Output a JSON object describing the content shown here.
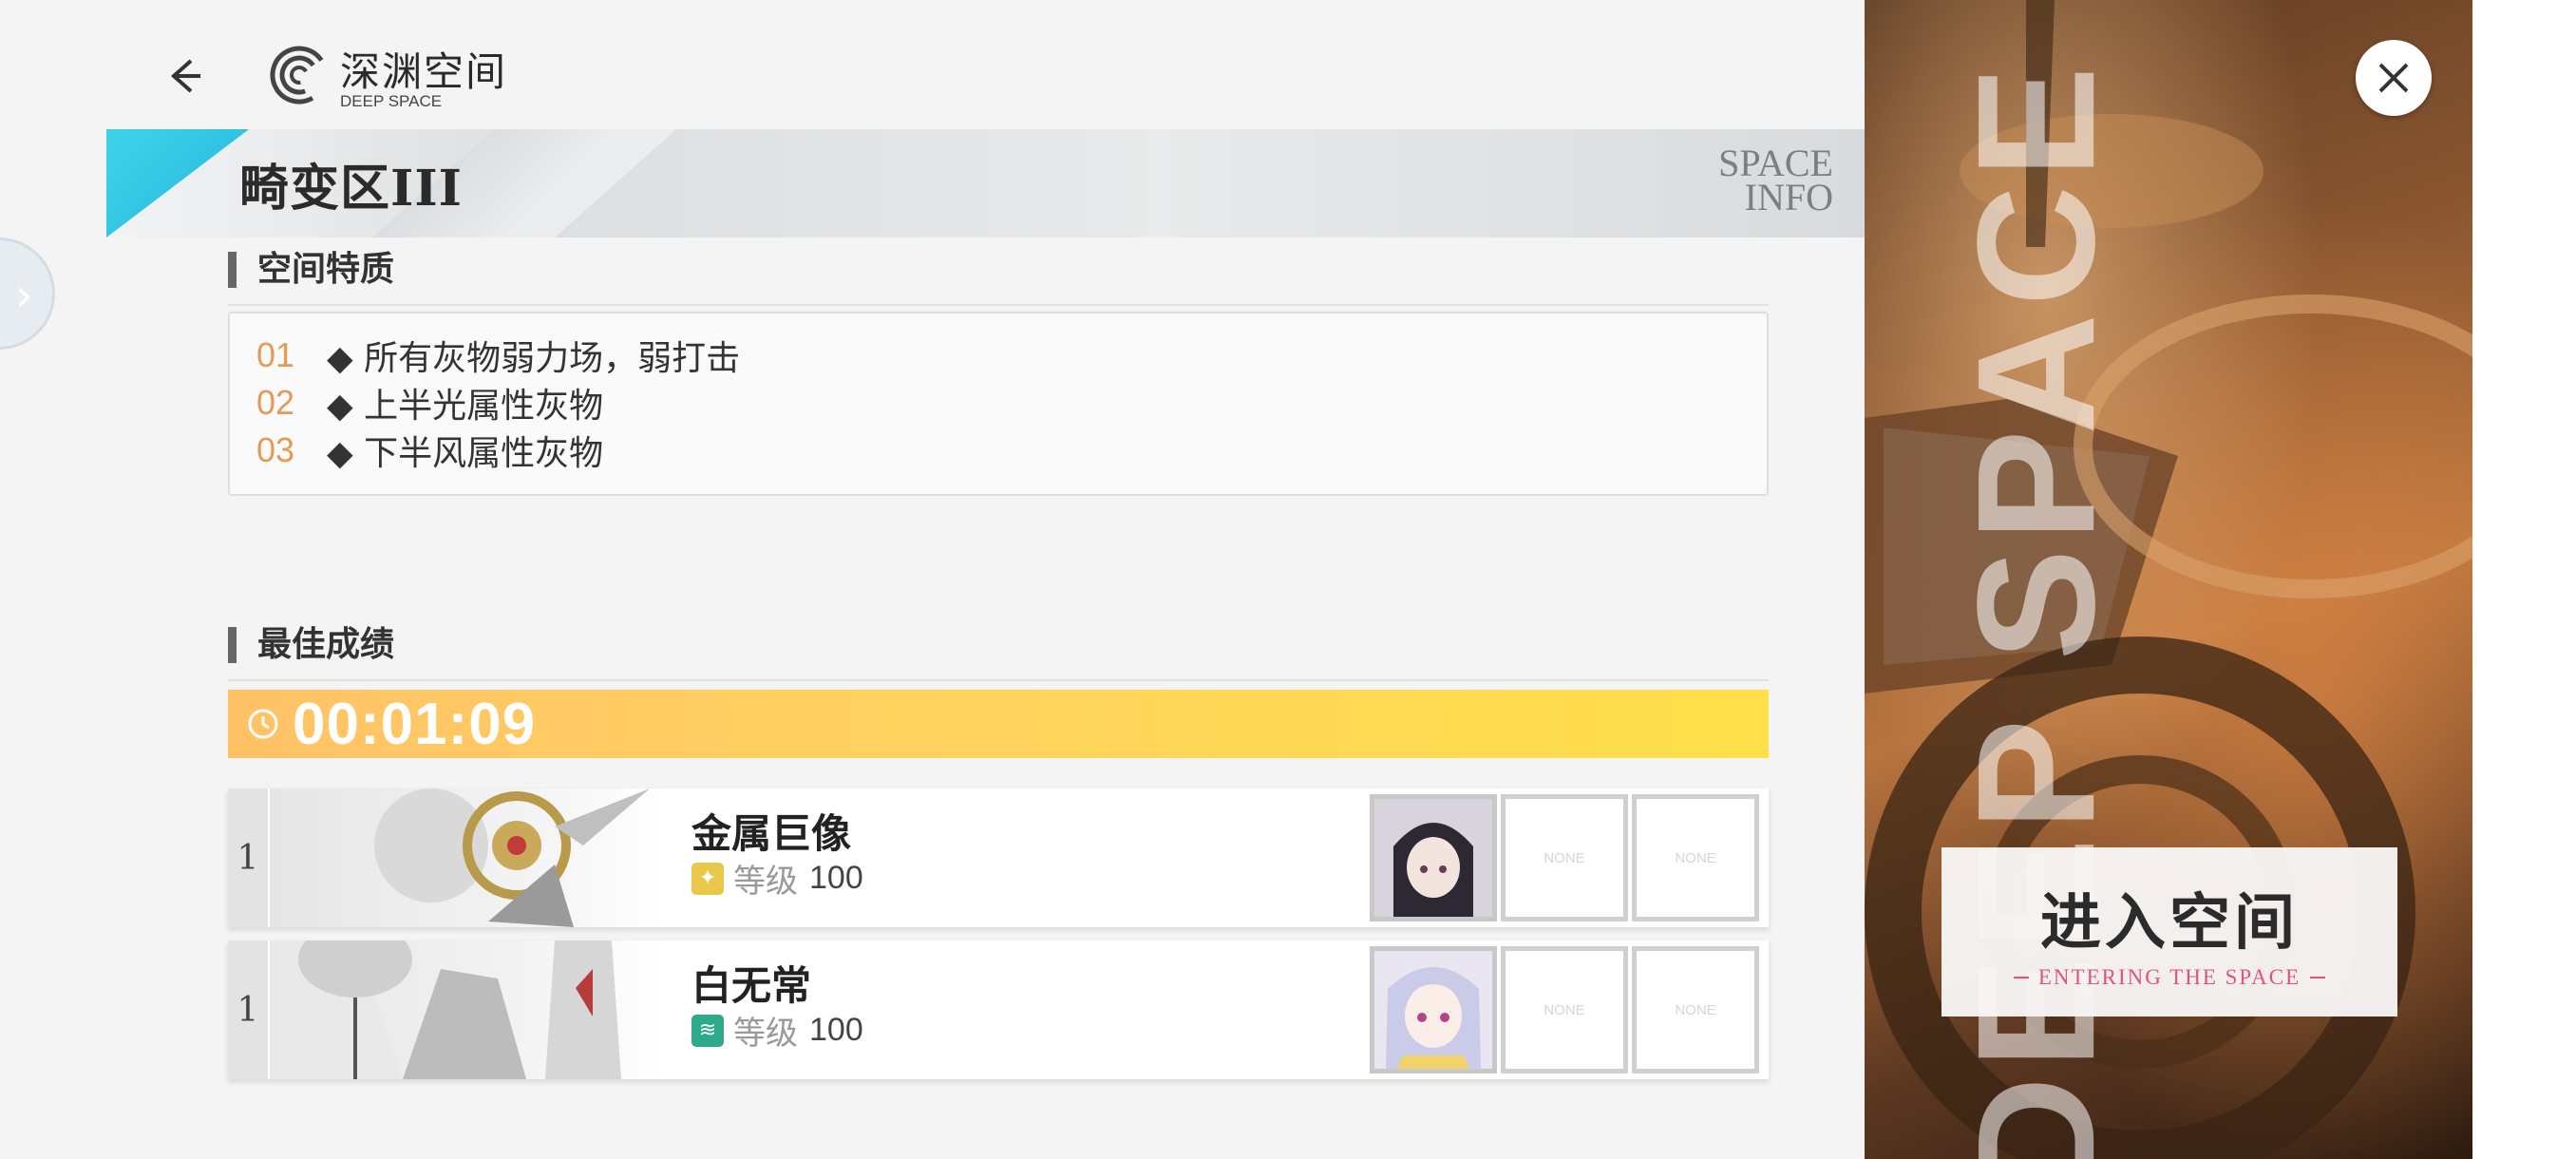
{
  "header": {
    "back_icon": "arrow-left-icon",
    "logo_icon": "spiral-logo-icon",
    "title": "深渊空间",
    "subtitle": "DEEP SPACE"
  },
  "banner": {
    "zone_title": "畸变区III",
    "side_text_line1": "SPACE",
    "side_text_line2": "INFO",
    "accent_color": "#2cc4e3"
  },
  "traits": {
    "heading": "空间特质",
    "items": [
      {
        "num": "01",
        "text": "◆ 所有灰物弱力场，弱打击"
      },
      {
        "num": "02",
        "text": "◆ 上半光属性灰物"
      },
      {
        "num": "03",
        "text": "◆ 下半风属性灰物"
      }
    ]
  },
  "best": {
    "heading": "最佳成绩",
    "time": "00:01:09",
    "clock_icon": "clock-icon",
    "bar_color": "#ffcc5e"
  },
  "bosses": [
    {
      "rank": "1",
      "name": "金属巨像",
      "element_icon": "light-element-icon",
      "element_color": "#e8c74a",
      "level_label": "等级",
      "level_value": "100",
      "slots": [
        "NONE",
        "NONE"
      ]
    },
    {
      "rank": "1",
      "name": "白无常",
      "element_icon": "wind-element-icon",
      "element_color": "#2fa98c",
      "level_label": "等级",
      "level_value": "100",
      "slots": [
        "NONE",
        "NONE"
      ]
    }
  ],
  "right_panel": {
    "vertical_text": "DEEP SPACE",
    "enter_label": "进入空间",
    "enter_sub": "ENTERING THE SPACE",
    "close_icon": "close-icon"
  }
}
